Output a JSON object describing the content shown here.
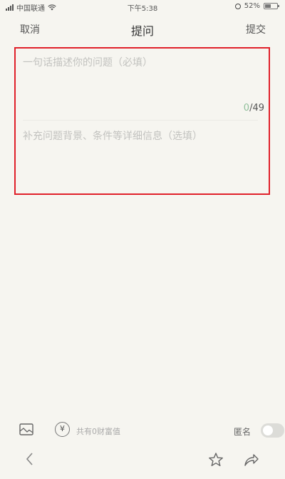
{
  "status_bar": {
    "carrier": "中国联通",
    "time": "下午5:38",
    "battery": "52%",
    "battery_level": 0.52
  },
  "nav": {
    "cancel_label": "取消",
    "title": "提问",
    "submit_label": "提交"
  },
  "form": {
    "title_placeholder": "一句话描述你的问题（必填）",
    "title_value": "",
    "counter_current": "0",
    "counter_max": "/49",
    "detail_placeholder": "补充问题背景、条件等详细信息（选填）",
    "detail_value": ""
  },
  "toolbar": {
    "reward_icon_glyph": "¥",
    "reward_text": "共有0财富值",
    "anonymous_label": "匿名",
    "anonymous_on": false
  },
  "icons": {
    "image": "image-icon",
    "reward": "yuan-icon",
    "back": "back-arrow-icon",
    "favorite": "star-icon",
    "share": "share-icon"
  },
  "colors": {
    "highlight_border": "#e0202a",
    "counter_current": "#8fbf9a",
    "placeholder": "#c2c2bf"
  }
}
